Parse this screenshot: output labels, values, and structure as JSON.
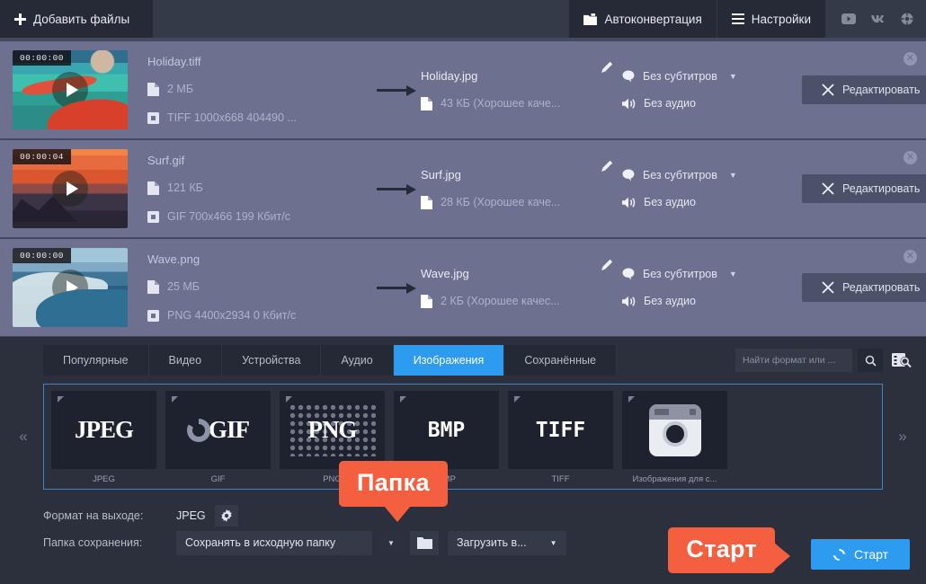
{
  "toolbar": {
    "add_files": "Добавить файлы",
    "autoconvert": "Автоконвертация",
    "settings": "Настройки",
    "social": [
      "youtube-icon",
      "vk-icon",
      "help-icon"
    ]
  },
  "files": [
    {
      "timestamp": "00:00:00",
      "source_name": "Holiday.tiff",
      "source_size": "2 МБ",
      "source_info": "TIFF 1000x668 404490 ...",
      "dest_name": "Holiday.jpg",
      "dest_size": "43 КБ (Хорошее каче...",
      "subtitles": "Без субтитров",
      "audio": "Без аудио",
      "edit": "Редактировать"
    },
    {
      "timestamp": "00:00:04",
      "source_name": "Surf.gif",
      "source_size": "121 КБ",
      "source_info": "GIF 700x466 199 Кбит/с",
      "dest_name": "Surf.jpg",
      "dest_size": "28 КБ (Хорошее каче...",
      "subtitles": "Без субтитров",
      "audio": "Без аудио",
      "edit": "Редактировать"
    },
    {
      "timestamp": "00:00:00",
      "source_name": "Wave.png",
      "source_size": "25 МБ",
      "source_info": "PNG 4400x2934 0 Кбит/с",
      "dest_name": "Wave.jpg",
      "dest_size": "2 КБ (Хорошее качес...",
      "subtitles": "Без субтитров",
      "audio": "Без аудио",
      "edit": "Редактировать"
    }
  ],
  "tabs": [
    {
      "label": "Популярные",
      "active": false
    },
    {
      "label": "Видео",
      "active": false
    },
    {
      "label": "Устройства",
      "active": false
    },
    {
      "label": "Аудио",
      "active": false
    },
    {
      "label": "Изображения",
      "active": true
    },
    {
      "label": "Сохранённые",
      "active": false
    }
  ],
  "search": {
    "placeholder": "Найти формат или ...",
    "value": ""
  },
  "formats": [
    {
      "art": "JPEG",
      "label": "JPEG"
    },
    {
      "art": "GIF",
      "label": "GIF"
    },
    {
      "art": "PNG",
      "label": "PNG"
    },
    {
      "art": "BMP",
      "label": "BMP"
    },
    {
      "art": "TIFF",
      "label": "TIFF"
    },
    {
      "art": "instagram-icon",
      "label": "Изображения для с..."
    }
  ],
  "nav": {
    "prev": "«",
    "next": "»"
  },
  "bottom": {
    "output_format_label": "Формат на выходе:",
    "output_format_value": "JPEG",
    "save_folder_label": "Папка сохранения:",
    "save_folder_value": "Сохранять в исходную папку",
    "upload_value": "Загрузить в...",
    "start": "Старт"
  },
  "callouts": {
    "folder": "Папка",
    "start": "Старт"
  },
  "colors": {
    "accent": "#2d9cf0",
    "callout": "#f4603f",
    "panel": "#2b303c",
    "rows": "#6d718f"
  }
}
